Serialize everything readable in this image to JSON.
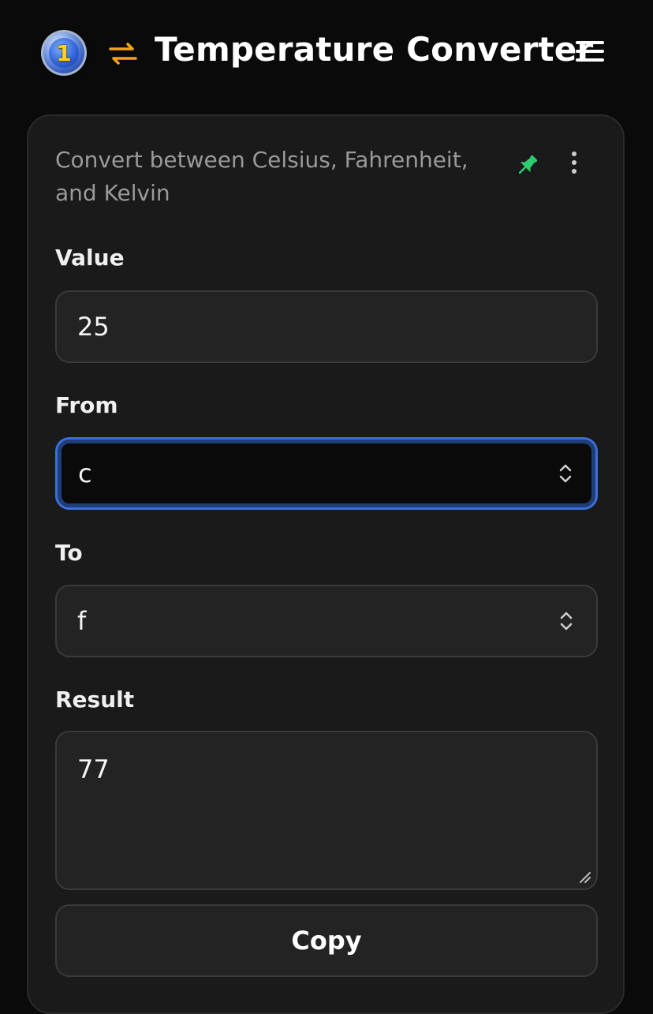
{
  "header": {
    "title": "Temperature Converter",
    "logo_text": "1",
    "swap_icon": "swap-arrows-icon",
    "menu_icon": "hamburger-menu-icon"
  },
  "card": {
    "description": "Convert between Celsius, Fahrenheit, and Kelvin",
    "pin_icon": "pin-icon",
    "more_icon": "more-vertical-icon",
    "value": {
      "label": "Value",
      "current": "25"
    },
    "from": {
      "label": "From",
      "selected": "c"
    },
    "to": {
      "label": "To",
      "selected": "f"
    },
    "result": {
      "label": "Result",
      "current": "77"
    },
    "copy_label": "Copy"
  },
  "colors": {
    "background": "#0a0a0a",
    "card": "#1a1a1a",
    "accent_orange": "#f5a31a",
    "pin_green": "#2ecc71",
    "focus_blue": "#3d6fd8"
  }
}
